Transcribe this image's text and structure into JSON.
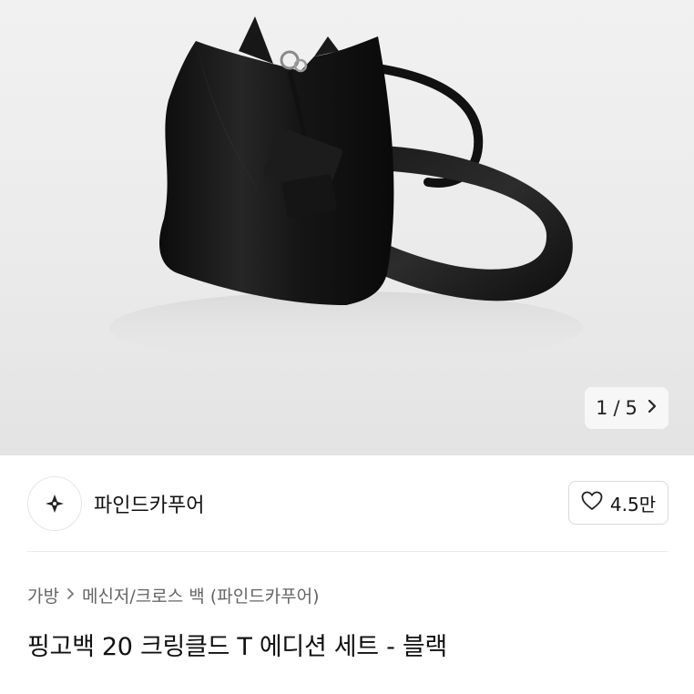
{
  "gallery": {
    "current": "1",
    "divider": "/",
    "total": "5",
    "next_icon": "chevron-right-icon"
  },
  "store": {
    "name": "파인드카푸어",
    "logo_icon": "store-logo-icon",
    "likes": "4.5만",
    "like_icon": "heart-outline-icon"
  },
  "breadcrumb": {
    "level1": "가방",
    "level2": "메신저/크로스 백 (파인드카푸어)"
  },
  "product": {
    "title": "핑고백 20 크링클드 T 에디션 세트 - 블랙"
  },
  "colors": {
    "hero_bg": "#ebebeb",
    "bag": "#141414",
    "text_primary": "#111111",
    "text_secondary": "#666666"
  }
}
